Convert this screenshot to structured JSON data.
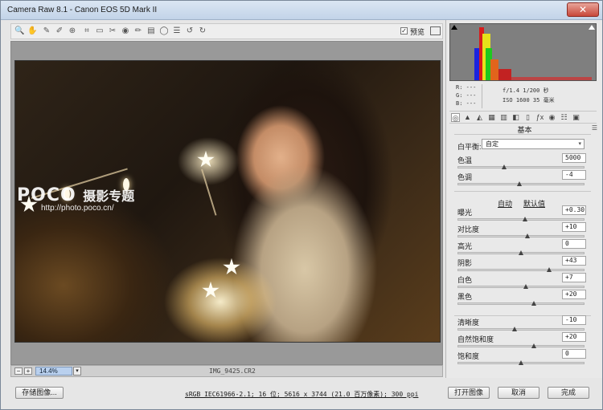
{
  "window": {
    "title": "Camera Raw 8.1 -  Canon EOS 5D Mark II",
    "close_glyph": "✕"
  },
  "toolbar": {
    "tools": [
      {
        "name": "zoom-tool",
        "glyph": "🔍"
      },
      {
        "name": "hand-tool",
        "glyph": "✋"
      },
      {
        "name": "white-balance-tool",
        "glyph": "✎"
      },
      {
        "name": "color-sampler-tool",
        "glyph": "✐"
      },
      {
        "name": "targeted-adjustment-tool",
        "glyph": "⊕"
      },
      {
        "name": "crop-tool",
        "glyph": "⌗"
      },
      {
        "name": "straighten-tool",
        "glyph": "▭"
      },
      {
        "name": "spot-removal-tool",
        "glyph": "✂"
      },
      {
        "name": "red-eye-tool",
        "glyph": "◉"
      },
      {
        "name": "adjustment-brush-tool",
        "glyph": "✏"
      },
      {
        "name": "graduated-filter-tool",
        "glyph": "▤"
      },
      {
        "name": "radial-filter-tool",
        "glyph": "◯"
      },
      {
        "name": "preferences-tool",
        "glyph": "☰"
      },
      {
        "name": "rotate-ccw-tool",
        "glyph": "↺"
      },
      {
        "name": "rotate-cw-tool",
        "glyph": "↻"
      }
    ],
    "preview_checked": true,
    "preview_check_glyph": "✓",
    "preview_label": "预览"
  },
  "photo": {
    "watermark_logo": "POCO",
    "watermark_sub": "摄影专题",
    "watermark_url": "http://photo.poco.cn/"
  },
  "statusbar": {
    "zoom_minus": "−",
    "zoom_plus": "+",
    "zoom": "14.4%",
    "zoom_arrow": "▾",
    "filename": "IMG_9425.CR2"
  },
  "footer": {
    "save_label": "存储图像...",
    "info_link": "sRGB IEC61966-2.1; 16 位; 5616 x 3744 (21.0 百万像素); 300 ppi",
    "open_label": "打开图像",
    "cancel_label": "取消",
    "done_label": "完成"
  },
  "readout": {
    "r": "R:  ---",
    "g": "G:  ---",
    "b": "B:  ---",
    "exposure": "f/1.4   1/200 秒",
    "iso": "ISO 1600   35 毫米"
  },
  "panel": {
    "section_title": "基本",
    "section_menu": "☰",
    "tabs": [
      "◎",
      "▲",
      "◭",
      "▦",
      "▥",
      "◧",
      "▯",
      "ƒx",
      "◉",
      "☷",
      "▣"
    ],
    "active_tab": 0,
    "wb_label": "白平衡:",
    "wb_value": "自定",
    "wb_arrow": "▾",
    "auto_label": "自动",
    "default_label": "默认值",
    "sliders": [
      {
        "label": "色温",
        "value": "5000",
        "level": 0.37
      },
      {
        "label": "色调",
        "value": "-4",
        "level": 0.49
      },
      {
        "label": "曝光",
        "value": "+0.30",
        "level": 0.53
      },
      {
        "label": "对比度",
        "value": "+10",
        "level": 0.55
      },
      {
        "label": "高光",
        "value": "0",
        "level": 0.5
      },
      {
        "label": "阴影",
        "value": "+43",
        "level": 0.72
      },
      {
        "label": "白色",
        "value": "+7",
        "level": 0.54
      },
      {
        "label": "黑色",
        "value": "+20",
        "level": 0.6
      },
      {
        "label": "清晰度",
        "value": "-10",
        "level": 0.45
      },
      {
        "label": "自然饱和度",
        "value": "+20",
        "level": 0.6
      },
      {
        "label": "饱和度",
        "value": "0",
        "level": 0.5
      }
    ]
  }
}
